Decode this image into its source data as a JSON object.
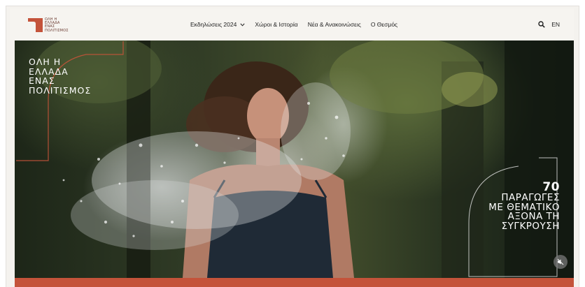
{
  "brand": {
    "logo_lines": [
      "ΟΛΗ Η",
      "ΕΛΛΑΔΑ",
      "ΕΝΑΣ",
      "ΠΟΛΙΤΙΣΜΟΣ"
    ],
    "accent_color": "#c4533a"
  },
  "nav": {
    "items": [
      {
        "label": "Εκδηλώσεις 2024",
        "has_dropdown": true,
        "icon": "chevron-down-icon"
      },
      {
        "label": "Χώροι & Ιστορία"
      },
      {
        "label": "Νέα & Ανακοινώσεις"
      },
      {
        "label": "Ο Θεσμός"
      }
    ]
  },
  "tools": {
    "search_icon": "search-icon",
    "language_label": "EN"
  },
  "hero": {
    "title_lines": [
      "ΟΛΗ Η",
      "ΕΛΛΑΔΑ",
      "ΕΝΑΣ",
      "ΠΟΛΙΤΙΣΜΟΣ"
    ],
    "stat_number": "70",
    "stat_lines": [
      "ΠΑΡΑΓΩΓΕΣ",
      "ΜΕ ΘΕΜΑΤΙΚΟ",
      "ΑΞΟΝΑ ΤΗ",
      "ΣΥΓΚΡΟΥΣΗ"
    ],
    "mute_icon": "muted-speaker-icon"
  }
}
